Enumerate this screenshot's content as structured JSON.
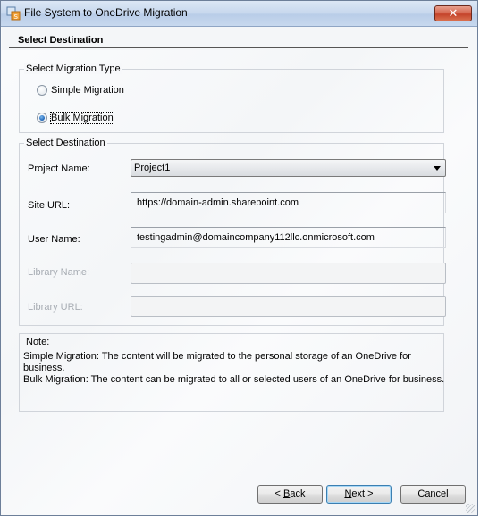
{
  "window": {
    "title": "File System to OneDrive Migration",
    "close_label": "✕"
  },
  "header": {
    "title": "Select Destination"
  },
  "migration_type": {
    "group_title": "Select Migration Type",
    "options": [
      {
        "label": "Simple Migration",
        "checked": false
      },
      {
        "label": "Bulk Migration",
        "checked": true
      }
    ]
  },
  "destination": {
    "group_title": "Select Destination",
    "project_name_label": "Project Name:",
    "project_name_value": "Project1",
    "site_url_label": "Site URL:",
    "site_url_value": "https://domain-admin.sharepoint.com",
    "user_name_label": "User Name:",
    "user_name_value": "testingadmin@domaincompany112llc.onmicrosoft.com",
    "library_name_label": "Library Name:",
    "library_name_value": "",
    "library_url_label": "Library URL:",
    "library_url_value": ""
  },
  "note": {
    "title": "Note:",
    "line1": "Simple Migration: The content will be migrated to the personal storage of an OneDrive for",
    "line2": "business.",
    "line3": "Bulk Migration: The content can be migrated to all or selected users of an OneDrive for business."
  },
  "buttons": {
    "back_mnemonic": "B",
    "back_rest": "ack",
    "back_prefix": "< ",
    "next_mnemonic": "N",
    "next_rest": "ext >",
    "cancel": "Cancel"
  },
  "colors": {
    "accent": "#1d63b5",
    "titlebar": "#c9d9ee",
    "close_button": "#c4432a",
    "disabled_text": "#a7acb3"
  }
}
